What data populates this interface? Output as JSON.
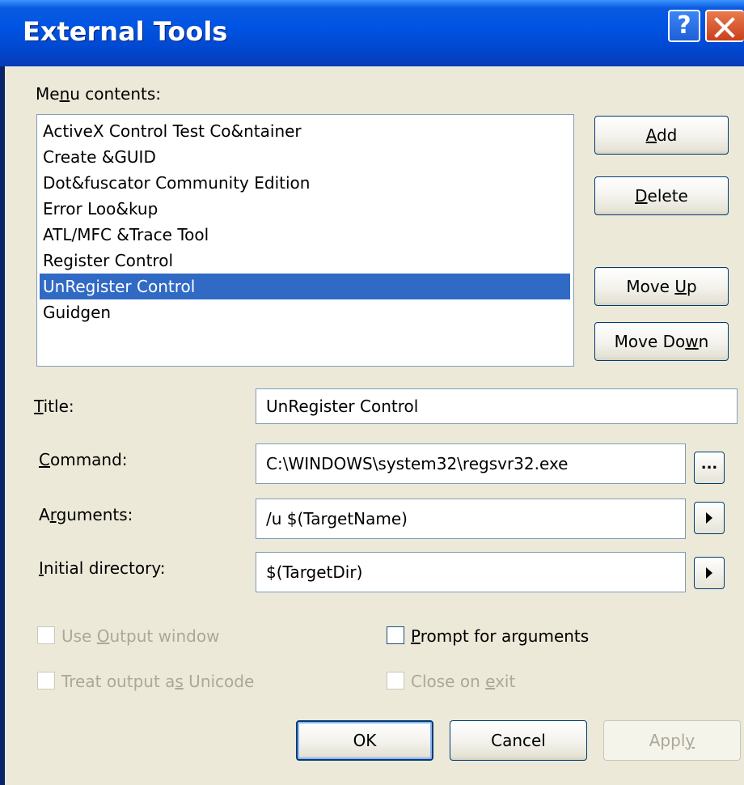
{
  "window": {
    "title": "External Tools",
    "help_label": "?"
  },
  "menu": {
    "label_pre": "Me",
    "label_u": "n",
    "label_post": "u contents:",
    "items": [
      "ActiveX Control Test Co&ntainer",
      "Create &GUID",
      "Dot&fuscator Community Edition",
      "Error Loo&kup",
      "ATL/MFC &Trace Tool",
      "Register Control",
      "UnRegister Control",
      "Guidgen"
    ],
    "selected_index": 6
  },
  "side_buttons": {
    "add": {
      "u": "A",
      "post": "dd"
    },
    "delete": {
      "u": "D",
      "post": "elete"
    },
    "move_up": {
      "pre": "Move ",
      "u": "U",
      "post": "p"
    },
    "move_down": {
      "pre": "Move Do",
      "u": "w",
      "post": "n"
    }
  },
  "fields": {
    "title": {
      "u": "T",
      "post": "itle:",
      "value": "UnRegister Control"
    },
    "command": {
      "u": "C",
      "post": "ommand:",
      "value": "C:\\WINDOWS\\system32\\regsvr32.exe",
      "browse_label": "..."
    },
    "arguments": {
      "pre": "A",
      "u": "r",
      "post": "guments:",
      "value": "/u $(TargetName)"
    },
    "initial_directory": {
      "u": "I",
      "post": "nitial directory:",
      "value": "$(TargetDir)"
    }
  },
  "options": {
    "use_output": {
      "pre": "Use ",
      "u": "O",
      "post": "utput window",
      "checked": false,
      "enabled": false
    },
    "prompt_args": {
      "u": "P",
      "post": "rompt for arguments",
      "checked": false,
      "enabled": true
    },
    "treat_unicode": {
      "pre": "Treat output a",
      "u": "s",
      "post": " Unicode",
      "checked": false,
      "enabled": false
    },
    "close_on_exit": {
      "pre": "Close on ",
      "u": "e",
      "post": "xit",
      "checked": false,
      "enabled": false
    }
  },
  "footer": {
    "ok": "OK",
    "cancel": "Cancel",
    "apply": {
      "pre": "Appl",
      "u": "y",
      "post": ""
    }
  },
  "colors": {
    "titlebar": "#0054e3",
    "dialog_bg": "#ece9d8",
    "selection": "#316ac5",
    "disabled_text": "#aca899"
  }
}
